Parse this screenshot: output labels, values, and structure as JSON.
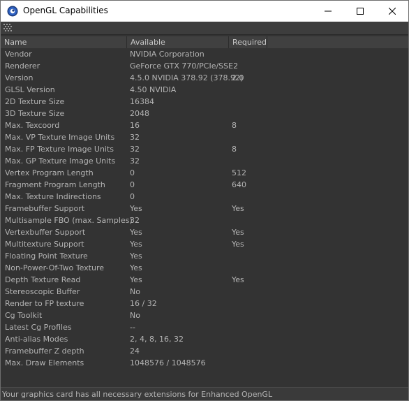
{
  "window": {
    "title": "OpenGL Capabilities",
    "app_icon": "cinema4d-icon",
    "controls": [
      "minimize-icon",
      "maximize-icon",
      "close-icon"
    ]
  },
  "toolbar": {
    "grip_icon": "grip-icon"
  },
  "columns": {
    "name": "Name",
    "available": "Available",
    "required": "Required"
  },
  "rows": [
    {
      "name": "Vendor",
      "available": "NVIDIA Corporation",
      "required": ""
    },
    {
      "name": "Renderer",
      "available": "GeForce GTX 770/PCIe/SSE2",
      "required": ""
    },
    {
      "name": "Version",
      "available": "4.5.0 NVIDIA 378.92 (378.92)",
      "required": "2.0"
    },
    {
      "name": "GLSL Version",
      "available": "4.50 NVIDIA",
      "required": ""
    },
    {
      "name": "2D Texture Size",
      "available": "16384",
      "required": ""
    },
    {
      "name": "3D Texture Size",
      "available": "2048",
      "required": ""
    },
    {
      "name": "Max. Texcoord",
      "available": "16",
      "required": "8"
    },
    {
      "name": "Max. VP Texture Image Units",
      "available": "32",
      "required": ""
    },
    {
      "name": "Max. FP Texture Image Units",
      "available": "32",
      "required": "8"
    },
    {
      "name": "Max. GP Texture Image Units",
      "available": "32",
      "required": ""
    },
    {
      "name": "Vertex Program Length",
      "available": "0",
      "required": "512"
    },
    {
      "name": "Fragment Program Length",
      "available": "0",
      "required": "640"
    },
    {
      "name": "Max. Texture Indirections",
      "available": "0",
      "required": ""
    },
    {
      "name": "Framebuffer Support",
      "available": "Yes",
      "required": "Yes"
    },
    {
      "name": "Multisample FBO (max. Samples)",
      "available": "32",
      "required": ""
    },
    {
      "name": "Vertexbuffer Support",
      "available": "Yes",
      "required": "Yes"
    },
    {
      "name": "Multitexture Support",
      "available": "Yes",
      "required": "Yes"
    },
    {
      "name": "Floating Point Texture",
      "available": "Yes",
      "required": ""
    },
    {
      "name": "Non-Power-Of-Two Texture",
      "available": "Yes",
      "required": ""
    },
    {
      "name": "Depth Texture Read",
      "available": "Yes",
      "required": "Yes"
    },
    {
      "name": "Stereoscopic Buffer",
      "available": "No",
      "required": ""
    },
    {
      "name": "Render to FP texture",
      "available": "16 / 32",
      "required": ""
    },
    {
      "name": "Cg Toolkit",
      "available": "No",
      "required": ""
    },
    {
      "name": "Latest Cg Profiles",
      "available": "--",
      "required": ""
    },
    {
      "name": "Anti-alias Modes",
      "available": "2, 4, 8, 16, 32",
      "required": ""
    },
    {
      "name": "Framebuffer Z depth",
      "available": "24",
      "required": ""
    },
    {
      "name": "Max. Draw Elements",
      "available": "1048576 / 1048576",
      "required": ""
    }
  ],
  "status": {
    "message": "Your graphics card has all necessary extensions for Enhanced OpenGL"
  }
}
